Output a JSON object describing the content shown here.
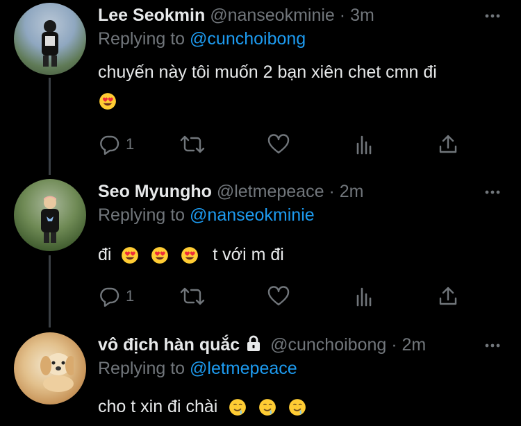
{
  "tweets": [
    {
      "name": "Lee Seokmin",
      "handle": "@nanseokminie",
      "dot": "·",
      "time": "3m",
      "replying_prefix": "Replying to",
      "replying_to": "@cunchoibong",
      "text": "chuyến này tôi muốn 2 bạn xiên chet cmn đi",
      "reply_count": "1"
    },
    {
      "name": "Seo Myungho",
      "handle": "@letmepeace",
      "dot": "·",
      "time": "2m",
      "replying_prefix": "Replying to",
      "replying_to": "@nanseokminie",
      "text_before": "đi",
      "text_after": "t với m đi",
      "reply_count": "1"
    },
    {
      "name": "vô địch hàn quắc",
      "handle": "@cunchoibong",
      "dot": "·",
      "time": "2m",
      "replying_prefix": "Replying to",
      "replying_to": "@letmepeace",
      "text": "cho t xin đi chài"
    }
  ],
  "icons": {
    "reply": "comment-icon",
    "retweet": "retweet-icon",
    "like": "heart-icon",
    "views": "analytics-icon",
    "share": "share-icon",
    "more": "more-icon",
    "protected": "lock-icon",
    "heart_eyes": "heart-eyes-emoji",
    "drool": "drooling-face-emoji"
  },
  "colors": {
    "background": "#000000",
    "text": "#e7e9ea",
    "muted": "#71767b",
    "mention": "#1d9bf0"
  }
}
